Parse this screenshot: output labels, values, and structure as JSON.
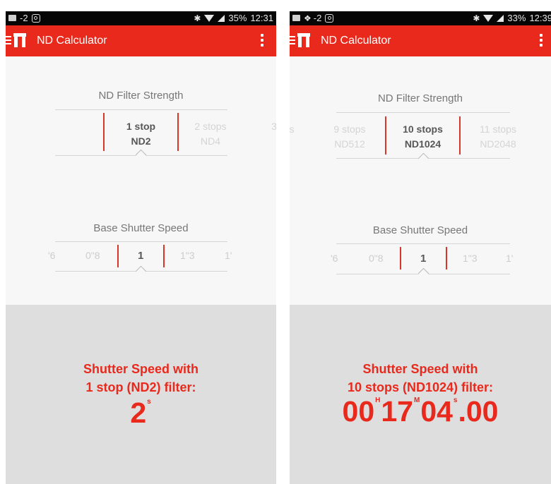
{
  "left": {
    "status": {
      "left": "-2",
      "battery": "35%",
      "time": "12:31"
    },
    "app_title": "ND Calculator",
    "nd_section": {
      "title": "ND Filter Strength"
    },
    "nd_picker": [
      {
        "stops": "1 stop",
        "nd": "ND2",
        "selected": true
      },
      {
        "stops": "2 stops",
        "nd": "ND4",
        "selected": false
      },
      {
        "stops": "3",
        "nd": "",
        "selected": false
      }
    ],
    "shutter_section": {
      "title": "Base Shutter Speed"
    },
    "shutter_picker": [
      {
        "label": "'6",
        "selected": false
      },
      {
        "label": "0\"8",
        "selected": false
      },
      {
        "label": "1",
        "selected": true
      },
      {
        "label": "1\"3",
        "selected": false
      },
      {
        "label": "1'",
        "selected": false
      }
    ],
    "result": {
      "line1": "Shutter Speed with",
      "line2": "1 stop (ND2) filter:",
      "value": "2",
      "unit": "s"
    }
  },
  "right": {
    "status": {
      "left": "-2",
      "battery": "33%",
      "time": "12:39"
    },
    "app_title": "ND Calculator",
    "nd_section": {
      "title": "ND Filter Strength"
    },
    "nd_picker": [
      {
        "stops": "s",
        "nd": "",
        "selected": false
      },
      {
        "stops": "9 stops",
        "nd": "ND512",
        "selected": false
      },
      {
        "stops": "10 stops",
        "nd": "ND1024",
        "selected": true
      },
      {
        "stops": "11 stops",
        "nd": "ND2048",
        "selected": false
      }
    ],
    "shutter_section": {
      "title": "Base Shutter Speed"
    },
    "shutter_picker": [
      {
        "label": "'6",
        "selected": false
      },
      {
        "label": "0\"8",
        "selected": false
      },
      {
        "label": "1",
        "selected": true
      },
      {
        "label": "1\"3",
        "selected": false
      },
      {
        "label": "1'",
        "selected": false
      }
    ],
    "result": {
      "line1": "Shutter Speed with",
      "line2": "10 stops (ND1024) filter:",
      "hours": "00",
      "h_unit": "H",
      "minutes": "17",
      "m_unit": "M",
      "seconds": "04",
      "s_unit": "s",
      "fraction": ".00"
    }
  },
  "colors": {
    "accent": "#e8291c",
    "status_bar": "#060606",
    "result_panel": "#dedede"
  }
}
